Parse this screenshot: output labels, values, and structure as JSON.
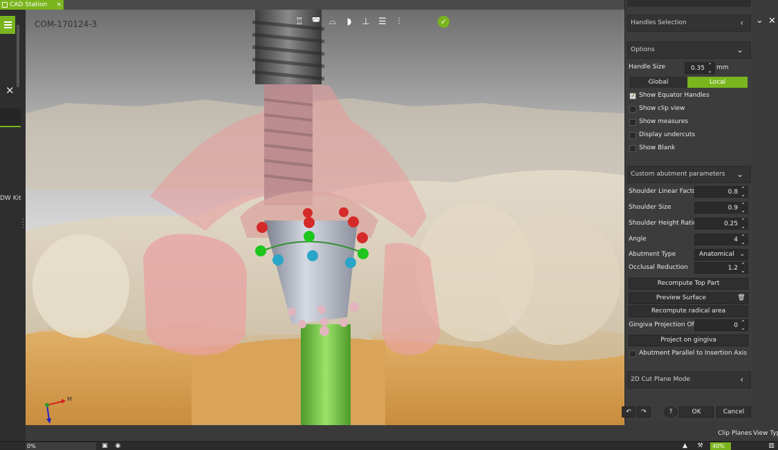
{
  "app": {
    "tab_title": "CAD Station",
    "tab_close": "×",
    "accent_color": "#7ab51d"
  },
  "left_panel": {
    "close_glyph": "✕",
    "kit_label": "DW Kit"
  },
  "viewport": {
    "case_id": "COM-170124-3",
    "axis_x_label": "M",
    "axis_y_label": ""
  },
  "side_panel": {
    "handles_selection": {
      "title": "Handles Selection",
      "chevron": "‹"
    },
    "options": {
      "title": "Options",
      "chevron": "⌄",
      "handle_size_label": "Handle Size",
      "handle_size_value": "0.35",
      "handle_size_unit": "mm",
      "mode_global": "Global",
      "mode_local": "Local",
      "active_mode": "Local",
      "checkboxes": [
        {
          "label": "Show Equator Handles",
          "checked": true
        },
        {
          "label": "Show clip view",
          "checked": false
        },
        {
          "label": "Show measures",
          "checked": false
        },
        {
          "label": "Display undercuts",
          "checked": false
        },
        {
          "label": "Show Blank",
          "checked": false
        }
      ]
    },
    "custom_abutment": {
      "title": "Custom abutment parameters",
      "chevron": "⌄",
      "params": [
        {
          "label": "Shoulder Linear Factor",
          "value": "0.8"
        },
        {
          "label": "Shoulder Size",
          "value": "0.9"
        },
        {
          "label": "Shoulder Height Ratio",
          "value": "0.25"
        },
        {
          "label": "Angle",
          "value": "4"
        }
      ],
      "abutment_type_label": "Abutment Type",
      "abutment_type_value": "Anatomical",
      "occlusal_reduction_label": "Occlusal Reduction",
      "occlusal_reduction_value": "1.2",
      "recompute_top_part": "Recompute Top Part",
      "preview_surface": "Preview Surface",
      "recompute_radical_area": "Recompute radical area",
      "gingiva_offset_label": "Gingiva Projection Offset",
      "gingiva_offset_value": "0",
      "project_on_gingiva": "Project on gingiva",
      "parallel_label": "Abutment Parallel to Insertion Axis",
      "parallel_checked": false
    },
    "cut_plane": {
      "title": "2D Cut Plane Mode",
      "chevron": "‹"
    },
    "footer": {
      "help": "?",
      "ok": "OK",
      "cancel": "Cancel"
    }
  },
  "bottom": {
    "clip_planes": "Clip Planes",
    "view_type": "View Typ",
    "progress_text": "0%",
    "zoom": "40%"
  }
}
